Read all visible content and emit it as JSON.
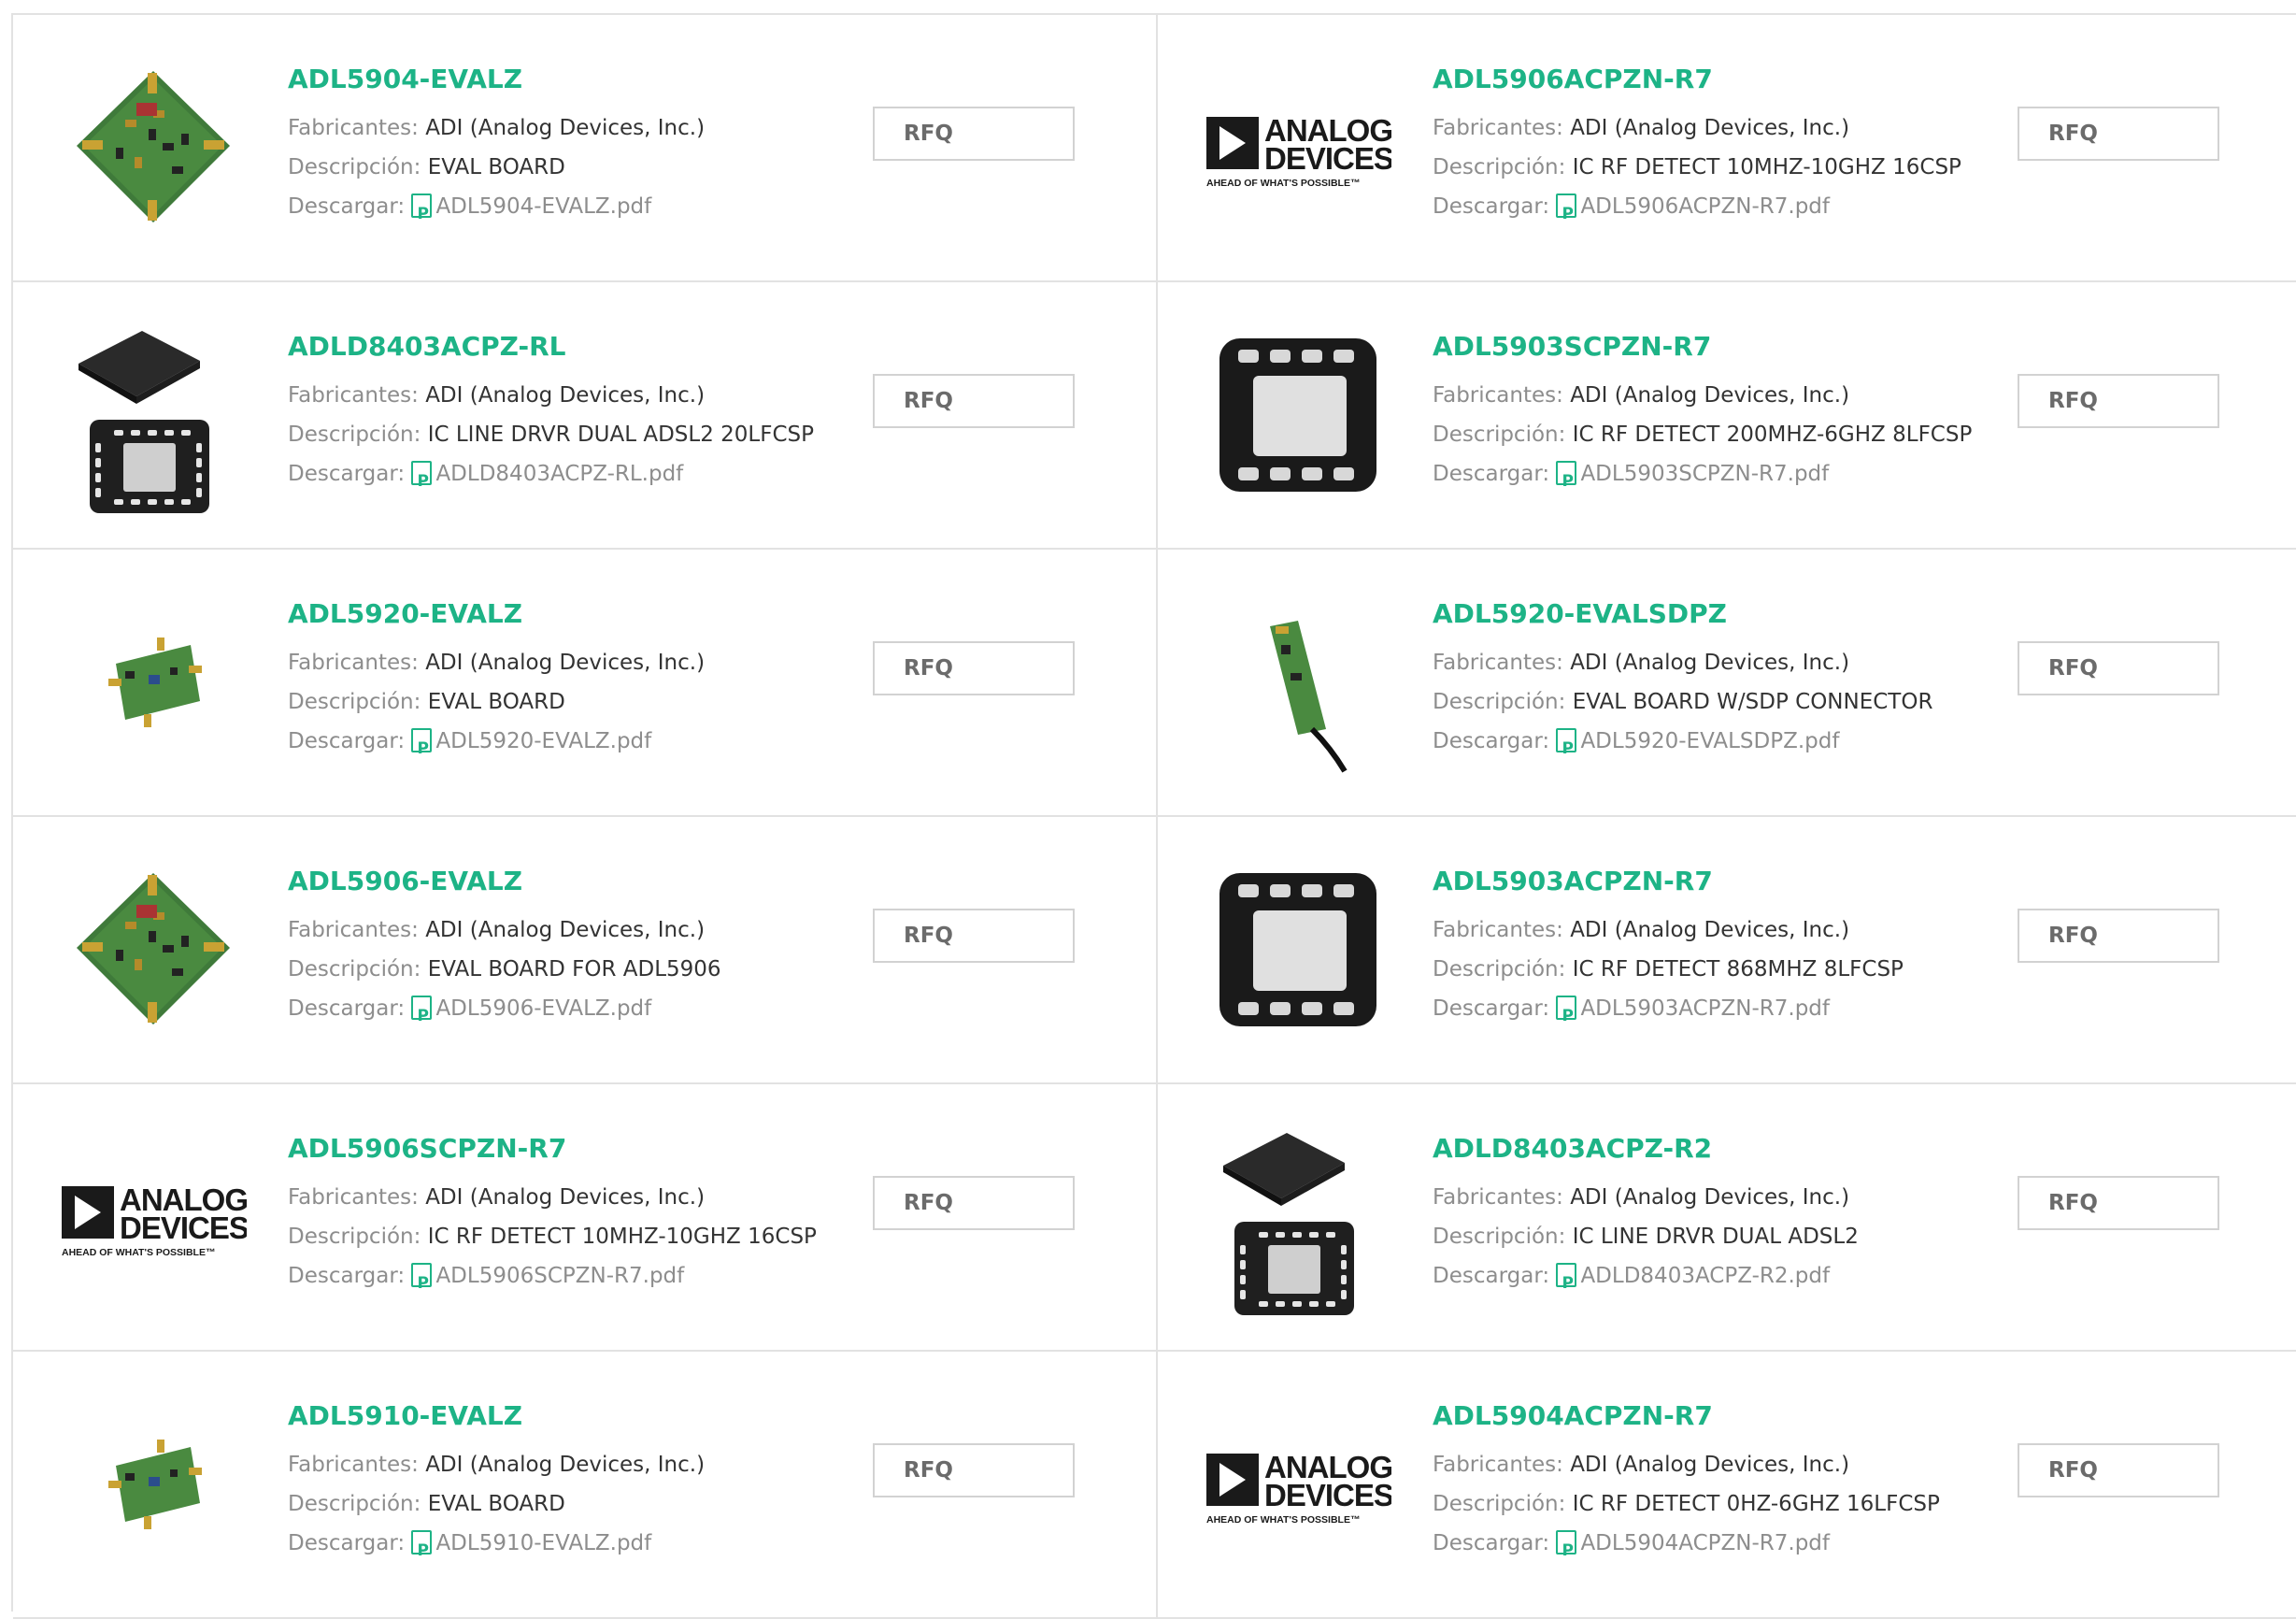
{
  "labels": {
    "manufacturer": "Fabricantes:",
    "description": "Descripción:",
    "download": "Descargar:",
    "rfq": "RFQ"
  },
  "brand_logo": {
    "line1": "ANALOG",
    "line2": "DEVICES",
    "tagline": "AHEAD OF WHAT'S POSSIBLE™"
  },
  "products": [
    {
      "part": "ADL5904-EVALZ",
      "manufacturer": "ADI (Analog Devices, Inc.)",
      "description": "EVAL BOARD",
      "file": "ADL5904-EVALZ.pdf",
      "image": "eval-board-large"
    },
    {
      "part": "ADL5906ACPZN-R7",
      "manufacturer": "ADI (Analog Devices, Inc.)",
      "description": "IC RF DETECT 10MHZ-10GHZ 16CSP",
      "file": "ADL5906ACPZN-R7.pdf",
      "image": "analog-devices-logo"
    },
    {
      "part": "ADLD8403ACPZ-RL",
      "manufacturer": "ADI (Analog Devices, Inc.)",
      "description": "IC LINE DRVR DUAL ADSL2 20LFCSP",
      "file": "ADLD8403ACPZ-RL.pdf",
      "image": "lfcsp-package"
    },
    {
      "part": "ADL5903SCPZN-R7",
      "manufacturer": "ADI (Analog Devices, Inc.)",
      "description": "IC RF DETECT 200MHZ-6GHZ 8LFCSP",
      "file": "ADL5903SCPZN-R7.pdf",
      "image": "8-lfcsp-package"
    },
    {
      "part": "ADL5920-EVALZ",
      "manufacturer": "ADI (Analog Devices, Inc.)",
      "description": "EVAL BOARD",
      "file": "ADL5920-EVALZ.pdf",
      "image": "eval-board-small"
    },
    {
      "part": "ADL5920-EVALSDPZ",
      "manufacturer": "ADI (Analog Devices, Inc.)",
      "description": "EVAL BOARD W/SDP CONNECTOR",
      "file": "ADL5920-EVALSDPZ.pdf",
      "image": "eval-board-cable"
    },
    {
      "part": "ADL5906-EVALZ",
      "manufacturer": "ADI (Analog Devices, Inc.)",
      "description": "EVAL BOARD FOR ADL5906",
      "file": "ADL5906-EVALZ.pdf",
      "image": "eval-board-large"
    },
    {
      "part": "ADL5903ACPZN-R7",
      "manufacturer": "ADI (Analog Devices, Inc.)",
      "description": "IC RF DETECT 868MHZ 8LFCSP",
      "file": "ADL5903ACPZN-R7.pdf",
      "image": "8-lfcsp-package"
    },
    {
      "part": "ADL5906SCPZN-R7",
      "manufacturer": "ADI (Analog Devices, Inc.)",
      "description": "IC RF DETECT 10MHZ-10GHZ 16CSP",
      "file": "ADL5906SCPZN-R7.pdf",
      "image": "analog-devices-logo"
    },
    {
      "part": "ADLD8403ACPZ-R2",
      "manufacturer": "ADI (Analog Devices, Inc.)",
      "description": "IC LINE DRVR DUAL ADSL2",
      "file": "ADLD8403ACPZ-R2.pdf",
      "image": "lfcsp-package"
    },
    {
      "part": "ADL5910-EVALZ",
      "manufacturer": "ADI (Analog Devices, Inc.)",
      "description": "EVAL BOARD",
      "file": "ADL5910-EVALZ.pdf",
      "image": "eval-board-small"
    },
    {
      "part": "ADL5904ACPZN-R7",
      "manufacturer": "ADI (Analog Devices, Inc.)",
      "description": "IC RF DETECT 0HZ-6GHZ 16LFCSP",
      "file": "ADL5904ACPZN-R7.pdf",
      "image": "analog-devices-logo"
    }
  ],
  "colors": {
    "accent": "#1db386",
    "label": "#8d8d8d",
    "text": "#333333",
    "border": "#e2e2e2"
  }
}
